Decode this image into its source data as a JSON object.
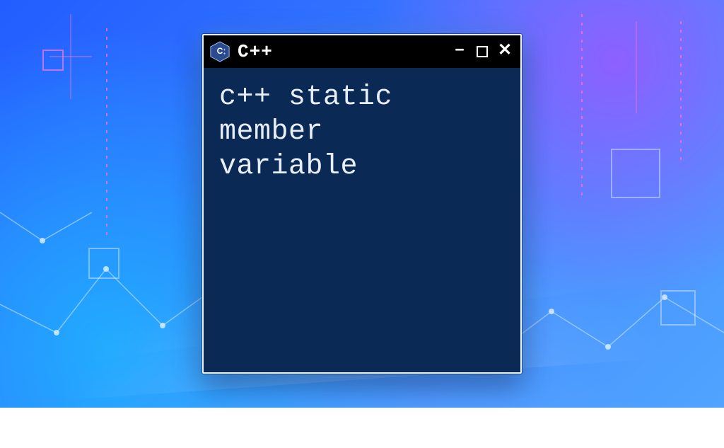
{
  "window": {
    "title": "C++",
    "icon_name": "cpp-hex-icon",
    "icon_letter": "C",
    "body_text": "c++ static\nmember\nvariable",
    "controls": {
      "minimize_glyph": "–",
      "close_glyph": "✕"
    }
  },
  "colors": {
    "console_bg": "#0a2a55",
    "titlebar_bg": "#000000",
    "text": "#e8eef6",
    "accent_blue": "#3b73ff",
    "accent_magenta": "#ff6edc",
    "cpp_icon_fill": "#2a4b8d"
  }
}
